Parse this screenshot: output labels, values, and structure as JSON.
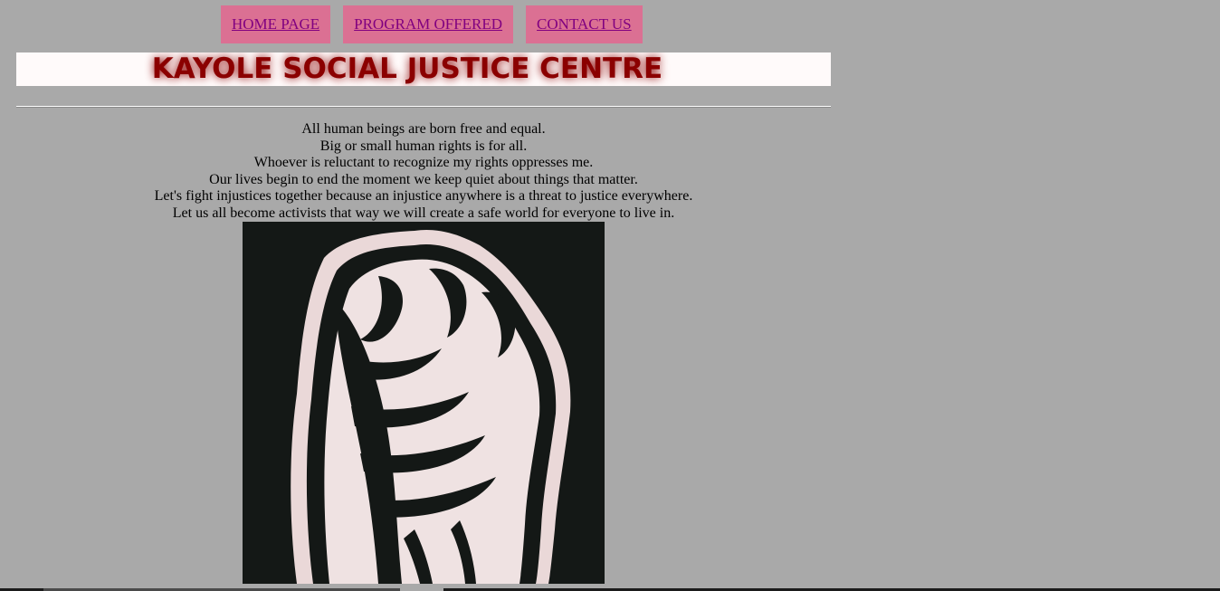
{
  "nav": {
    "items": [
      {
        "label": "HOME PAGE"
      },
      {
        "label": "PROGRAM OFFERED"
      },
      {
        "label": "CONTACT US"
      }
    ]
  },
  "banner": {
    "title": "KAYOLE SOCIAL JUSTICE CENTRE"
  },
  "quotes": [
    "All human beings are born free and equal.",
    "Big or small human rights is for all.",
    "Whoever is reluctant to recognize my rights oppresses me.",
    "Our lives begin to end the moment we keep quiet about things that matter.",
    "Let's fight injustices together because an injustice anywhere is a threat to justice everywhere.",
    "Let us all become activists that way we will create a safe world for everyone to live in."
  ],
  "image": {
    "icon": "raised-fist-icon"
  },
  "colors": {
    "background": "#a9a9a9",
    "nav_button": "#db7093",
    "nav_link": "#800080",
    "banner_bg": "#fffafa",
    "banner_text": "#8b0000"
  }
}
